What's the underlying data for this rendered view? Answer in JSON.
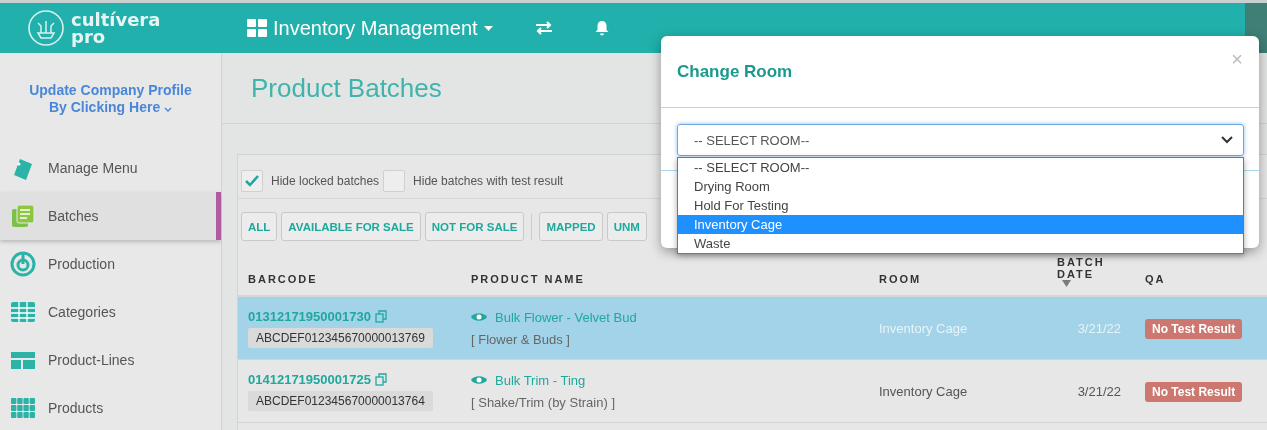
{
  "header": {
    "logo_line_1": "cultívera",
    "logo_line_2": "pro",
    "module": "Inventory Management"
  },
  "sidebar": {
    "profile_link": "Update Company Profile By Clicking Here",
    "items": [
      {
        "label": "Manage Menu",
        "kind": "menu",
        "selected": false
      },
      {
        "label": "Batches",
        "kind": "batches",
        "selected": true
      },
      {
        "label": "Production",
        "kind": "production",
        "selected": false
      },
      {
        "label": "Categories",
        "kind": "categories",
        "selected": false
      },
      {
        "label": "Product-Lines",
        "kind": "lines",
        "selected": false
      },
      {
        "label": "Products",
        "kind": "products",
        "selected": false
      }
    ]
  },
  "page_title": "Product Batches",
  "filters": [
    {
      "label": "Hide locked batches",
      "checked": true
    },
    {
      "label": "Hide batches with test result",
      "checked": false
    }
  ],
  "filter_buttons": [
    [
      "ALL",
      "AVAILABLE FOR SALE",
      "NOT FOR SALE"
    ],
    [
      "MAPPED",
      "UNM"
    ]
  ],
  "table": {
    "columns": [
      {
        "label": "BARCODE"
      },
      {
        "label": "PRODUCT NAME"
      },
      {
        "label": "ROOM"
      },
      {
        "label": "BATCH DATE",
        "sorted": true
      },
      {
        "label": "QA"
      }
    ],
    "rows": [
      {
        "selected": true,
        "barcode": "01312171950001730",
        "code": "ABCDEF012345670000013769",
        "product": "Bulk Flower - Velvet Bud",
        "category": "[ Flower & Buds ]",
        "room": "Inventory Cage",
        "date": "3/21/22",
        "qa": "No Test Result"
      },
      {
        "selected": false,
        "barcode": "01412171950001725",
        "code": "ABCDEF012345670000013764",
        "product": "Bulk Trim - Ting",
        "category": "[ Shake/Trim (by Strain) ]",
        "room": "Inventory Cage",
        "date": "3/21/22",
        "qa": "No Test Result"
      }
    ]
  },
  "modal": {
    "title": "Change Room",
    "close": "×",
    "select_value": "-- SELECT ROOM--",
    "options": [
      {
        "label": "-- SELECT ROOM--",
        "selected": false
      },
      {
        "label": "Drying Room",
        "selected": false
      },
      {
        "label": "Hold For Testing",
        "selected": false
      },
      {
        "label": "Inventory Cage",
        "selected": true
      },
      {
        "label": "Waste",
        "selected": false
      }
    ]
  }
}
